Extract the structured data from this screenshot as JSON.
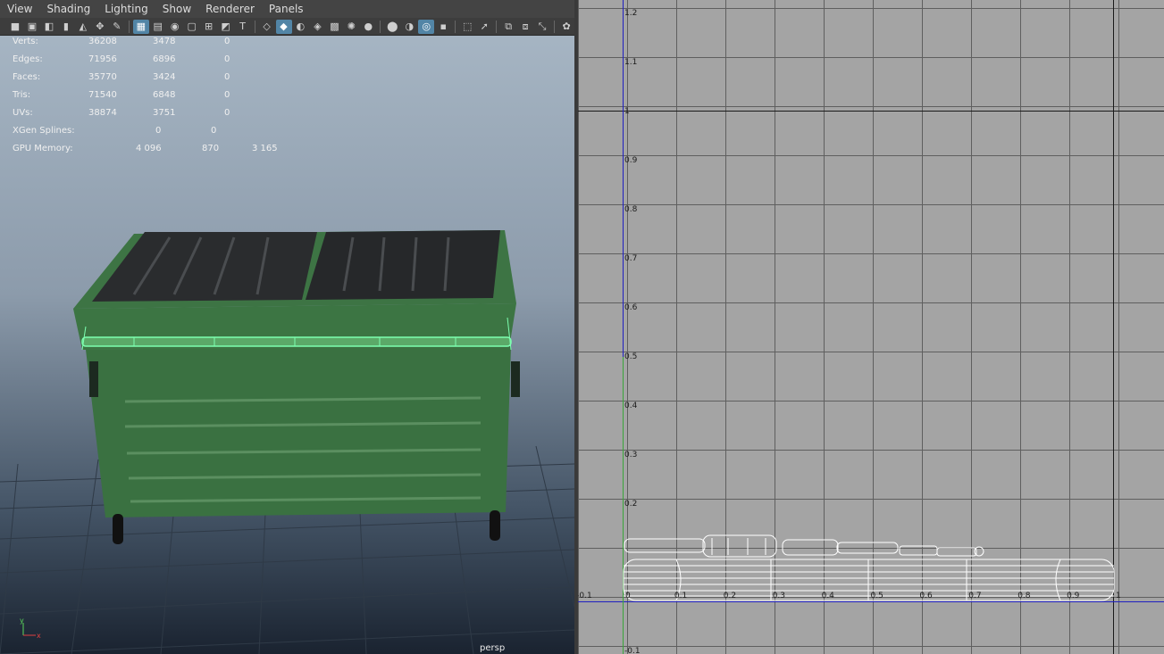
{
  "menu": [
    "View",
    "Shading",
    "Lighting",
    "Show",
    "Renderer",
    "Panels"
  ],
  "toolbar_icons": [
    "camera-icon",
    "camera-attr-icon",
    "bookmark-cam-icon",
    "bookmark-icon",
    "image-plane-icon",
    "pan-zoom-icon",
    "grease-pencil-icon",
    "grid-icon",
    "film-gate-icon",
    "resolution-gate-icon",
    "gate-mask-icon",
    "field-chart-icon",
    "safe-action-icon",
    "safe-title-icon",
    "wireframe-icon",
    "smooth-shade-icon",
    "default-material-icon",
    "xray-icon",
    "textured-icon",
    "lighting-icon",
    "shadows-icon",
    "ambient-occlusion-icon",
    "motion-blur-icon",
    "anti-alias-icon",
    "depth-of-field-icon",
    "isolate-icon",
    "select-icon",
    "xray-joints-icon",
    "xray-active-icon",
    "backface-icon",
    "render-icon"
  ],
  "stats": {
    "verts": {
      "label": "Verts:",
      "a": "36208",
      "b": "3478",
      "c": "0"
    },
    "edges": {
      "label": "Edges:",
      "a": "71956",
      "b": "6896",
      "c": "0"
    },
    "faces": {
      "label": "Faces:",
      "a": "35770",
      "b": "3424",
      "c": "0"
    },
    "tris": {
      "label": "Tris:",
      "a": "71540",
      "b": "6848",
      "c": "0"
    },
    "uvs": {
      "label": "UVs:",
      "a": "38874",
      "b": "3751",
      "c": "0"
    },
    "xgen": {
      "label": "XGen Splines:",
      "a": "0",
      "b": "0"
    },
    "gpu": {
      "label": "GPU Memory:",
      "a": "4 096",
      "b": "870",
      "c": "3 165"
    }
  },
  "viewport_label": "persp",
  "axis": {
    "y": "y",
    "x": "x"
  },
  "uv_v_ticks": [
    "1.2",
    "1.1",
    "1",
    "0.9",
    "0.8",
    "0.7",
    "0.6",
    "0.5",
    "0.4",
    "0.3",
    "0.2",
    "-0.1"
  ],
  "uv_u_ticks": [
    "-0.1",
    "0",
    "0.1",
    "0.2",
    "0.3",
    "0.4",
    "0.5",
    "0.6",
    "0.7",
    "0.8",
    "0.9",
    "1"
  ],
  "colors": {
    "mesh_green": "#3f7a45",
    "lid": "#2a2c2e",
    "selection": "#7dffb0",
    "uv_bg": "#a4a4a4"
  }
}
